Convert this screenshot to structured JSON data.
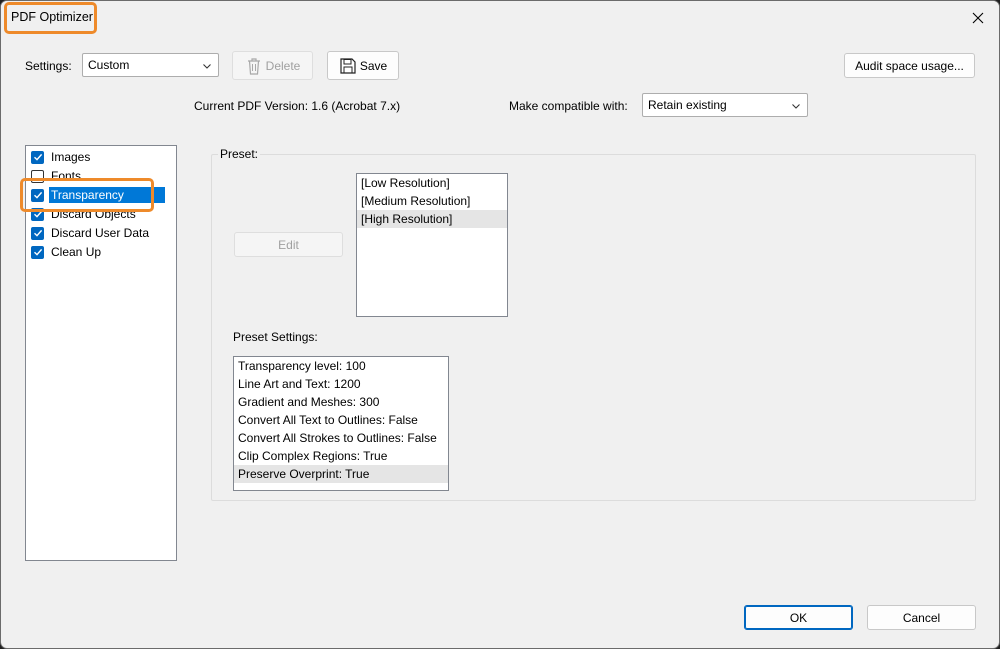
{
  "window": {
    "title": "PDF Optimizer"
  },
  "toolbar": {
    "settings_label": "Settings:",
    "settings_value": "Custom",
    "delete_label": "Delete",
    "save_label": "Save",
    "audit_label": "Audit space usage..."
  },
  "version": {
    "current_label": "Current PDF Version: 1.6 (Acrobat 7.x)",
    "compat_label": "Make compatible with:",
    "compat_value": "Retain existing"
  },
  "panels": [
    {
      "label": "Images",
      "checked": true,
      "selected": false
    },
    {
      "label": "Fonts",
      "checked": false,
      "selected": false
    },
    {
      "label": "Transparency",
      "checked": true,
      "selected": true
    },
    {
      "label": "Discard Objects",
      "checked": true,
      "selected": false
    },
    {
      "label": "Discard User Data",
      "checked": true,
      "selected": false
    },
    {
      "label": "Clean Up",
      "checked": true,
      "selected": false
    }
  ],
  "preset": {
    "caption": "Preset:",
    "edit_label": "Edit",
    "items": [
      "[Low Resolution]",
      "[Medium Resolution]",
      "[High Resolution]"
    ],
    "selected_index": 2,
    "settings_caption": "Preset Settings:",
    "settings_items": [
      "Transparency level: 100",
      "Line Art and Text: 1200",
      "Gradient and Meshes: 300",
      "Convert All Text to Outlines: False",
      "Convert All Strokes to Outlines: False",
      "Clip Complex Regions: True",
      "Preserve Overprint: True"
    ],
    "settings_selected_index": 6
  },
  "footer": {
    "ok_label": "OK",
    "cancel_label": "Cancel"
  },
  "colors": {
    "accent": "#0067c0",
    "selection": "#0078d7",
    "highlight_annotation": "#ee8a2a"
  }
}
